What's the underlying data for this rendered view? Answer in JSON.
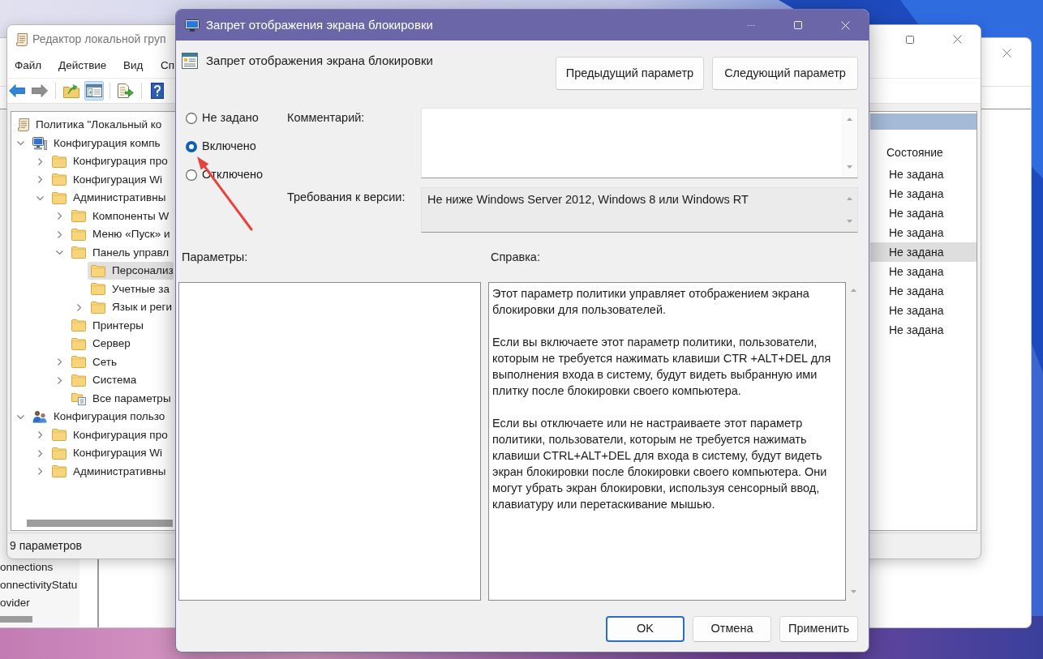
{
  "background_window": {
    "list_items": [
      "onnections",
      "onnectivityStatu",
      "ovider"
    ]
  },
  "editor_window": {
    "title": "Редактор локальной груп",
    "menu": [
      "Файл",
      "Действие",
      "Вид",
      "Сп"
    ],
    "toolbar": [
      [
        {
          "kind": "back",
          "disabled": false,
          "pressed": false
        },
        {
          "kind": "forward",
          "disabled": true,
          "pressed": false
        }
      ],
      [
        {
          "kind": "up",
          "disabled": false,
          "pressed": false
        },
        {
          "kind": "console_tree",
          "disabled": false,
          "pressed": true
        }
      ],
      [
        {
          "kind": "export",
          "disabled": false,
          "pressed": false
        }
      ],
      [
        {
          "kind": "help",
          "disabled": false,
          "pressed": false
        }
      ]
    ],
    "tree": [
      {
        "label": "Политика \"Локальный ко",
        "kind": "policy",
        "selected": false,
        "children": [
          {
            "label": "Конфигурация компь",
            "kind": "computer",
            "expanded": true,
            "selected": false,
            "children": [
              {
                "label": "Конфигурация про",
                "kind": "folder",
                "expanded": false,
                "selected": false
              },
              {
                "label": "Конфигурация Wi",
                "kind": "folder",
                "expanded": false,
                "selected": false
              },
              {
                "label": "Административны",
                "kind": "folder",
                "expanded": true,
                "selected": false,
                "children": [
                  {
                    "label": "Компоненты W",
                    "kind": "folder",
                    "expanded": false,
                    "selected": false
                  },
                  {
                    "label": "Меню «Пуск» и",
                    "kind": "folder",
                    "expanded": false,
                    "selected": false
                  },
                  {
                    "label": "Панель управл",
                    "kind": "folder",
                    "expanded": true,
                    "selected": false,
                    "children": [
                      {
                        "label": "Персонализ",
                        "kind": "folder",
                        "selected": true
                      },
                      {
                        "label": "Учетные за",
                        "kind": "folder",
                        "selected": false
                      },
                      {
                        "label": "Язык и реги",
                        "kind": "folder",
                        "expanded": false,
                        "selected": false
                      }
                    ]
                  },
                  {
                    "label": "Принтеры",
                    "kind": "folder",
                    "selected": false
                  },
                  {
                    "label": "Сервер",
                    "kind": "folder",
                    "selected": false
                  },
                  {
                    "label": "Сеть",
                    "kind": "folder",
                    "expanded": false,
                    "selected": false
                  },
                  {
                    "label": "Система",
                    "kind": "folder",
                    "expanded": false,
                    "selected": false
                  },
                  {
                    "label": "Все параметры",
                    "kind": "all_settings",
                    "selected": false
                  }
                ]
              }
            ]
          },
          {
            "label": "Конфигурация пользо",
            "kind": "user",
            "expanded": true,
            "selected": false,
            "children": [
              {
                "label": "Конфигурация про",
                "kind": "folder",
                "expanded": false,
                "selected": false
              },
              {
                "label": "Конфигурация Wi",
                "kind": "folder",
                "expanded": false,
                "selected": false
              },
              {
                "label": "Административны",
                "kind": "folder",
                "expanded": false,
                "selected": false
              }
            ]
          }
        ]
      }
    ],
    "list": {
      "columns": [
        "Состояние"
      ],
      "rows": [
        {
          "state": "Не задана",
          "selected": false
        },
        {
          "state": "Не задана",
          "selected": false
        },
        {
          "state": "Не задана",
          "selected": false
        },
        {
          "state": "Не задана",
          "selected": false
        },
        {
          "state": "Не задана",
          "selected": true
        },
        {
          "state": "Не задана",
          "selected": false
        },
        {
          "state": "Не задана",
          "selected": false
        },
        {
          "state": "Не задана",
          "selected": false
        },
        {
          "state": "Не задана",
          "selected": false
        }
      ]
    },
    "status_bar": "9 параметров"
  },
  "dialog": {
    "title": "Запрет отображения экрана блокировки",
    "minimize_disabled": true,
    "heading": "Запрет отображения экрана блокировки",
    "nav_buttons": [
      "Предыдущий параметр",
      "Следующий параметр"
    ],
    "options": [
      {
        "label": "Не задано",
        "selected": false
      },
      {
        "label": "Включено",
        "selected": true
      },
      {
        "label": "Отключено",
        "selected": false
      }
    ],
    "comment": {
      "label": "Комментарий:"
    },
    "supported_on": {
      "label": "Требования к версии:",
      "value": "Не ниже Windows Server 2012, Windows 8 или Windows RT"
    },
    "options_pane": {
      "label": "Параметры:"
    },
    "help": {
      "label": "Справка:",
      "paragraphs": [
        "Этот параметр политики управляет отображением экрана блокировки для пользователей.",
        "Если вы включаете этот параметр политики, пользователи, которым не требуется нажимать клавиши CTR +ALT+DEL для выполнения входа в систему, будут видеть выбранную ими плитку после блокировки своего компьютера.",
        "Если вы отключаете или не настраиваете этот параметр политики, пользователи, которым не требуется нажимать клавиши CTRL+ALT+DEL для входа в систему, будут видеть экран блокировки после блокировки своего компьютера. Они могут убрать экран блокировки, используя сенсорный ввод, клавиатуру или перетаскивание мышью."
      ]
    },
    "buttons": [
      {
        "label": "OK",
        "default": true
      },
      {
        "label": "Отмена",
        "default": false
      },
      {
        "label": "Применить",
        "default": false
      }
    ]
  }
}
